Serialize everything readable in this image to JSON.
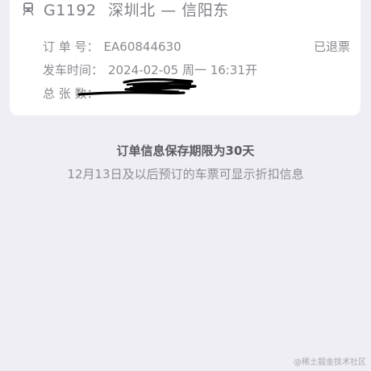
{
  "order_card": {
    "train_number": "G1192",
    "route": "深圳北 — 信阳东",
    "status": "已退票",
    "order_number_label": "订 单 号：",
    "order_number": "EA60844630",
    "departure_label": "发车时间：",
    "departure_time": "2024-02-05 周一 16:31开",
    "total_count_label": "总 张 数："
  },
  "notice": {
    "title": "订单信息保存期限为30天",
    "subtitle": "12月13日及以后预订的车票可显示折扣信息"
  },
  "watermark": "@稀土掘金技术社区",
  "icons": {
    "train": "train-icon"
  },
  "colors": {
    "background": "#efeef4",
    "card": "#ffffff",
    "muted_text": "#8a8a90",
    "emphasis_text": "#5a5a60",
    "scribble": "#000000"
  }
}
